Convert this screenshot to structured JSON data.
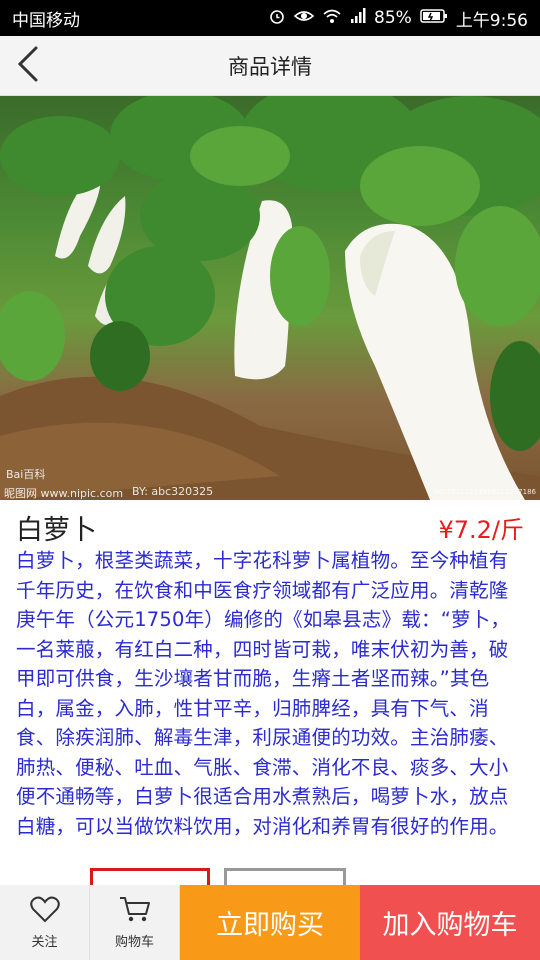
{
  "status_bar": {
    "carrier": "中国移动",
    "battery": "85%",
    "time": "上午9:56"
  },
  "nav": {
    "title": "商品详情",
    "back_icon": "chevron-left-icon"
  },
  "hero_image": {
    "watermark_brand": "Bai百科",
    "watermark_site": "昵图网 www.nipic.com",
    "watermark_author": "BY: abc320325",
    "watermark_id": "NO:20111221919113237186"
  },
  "product": {
    "name": "白萝卜",
    "price": "¥7.2/斤",
    "description": "白萝卜，根茎类蔬菜，十字花科萝卜属植物。至今种植有千年历史，在饮食和中医食疗领域都有广泛应用。清乾隆庚午年（公元1750年）编修的《如皋县志》载：“萝卜，一名莱菔，有红白二种，四时皆可栽，唯末伏初为善，破甲即可供食，生沙壤者甘而脆，生瘠土者坚而辣。”其色白，属金，入肺，性甘平辛，归肺脾经，具有下气、消食、除疾润肺、解毒生津，利尿通便的功效。主治肺痿、肺热、便秘、吐血、气胀、食滞、消化不良、痰多、大小便不通畅等，白萝卜很适合用水煮熟后，喝萝卜水，放点白糖，可以当做饮料饮用，对消化和养胃有很好的作用。"
  },
  "bottom_bar": {
    "follow_label": "关注",
    "cart_label": "购物车",
    "buy_now_label": "立即购买",
    "add_cart_label": "加入购物车"
  },
  "colors": {
    "price": "#e81c1c",
    "description": "#2b2bd0",
    "buy_now_bg": "#f89a17",
    "add_cart_bg": "#f0504f"
  }
}
